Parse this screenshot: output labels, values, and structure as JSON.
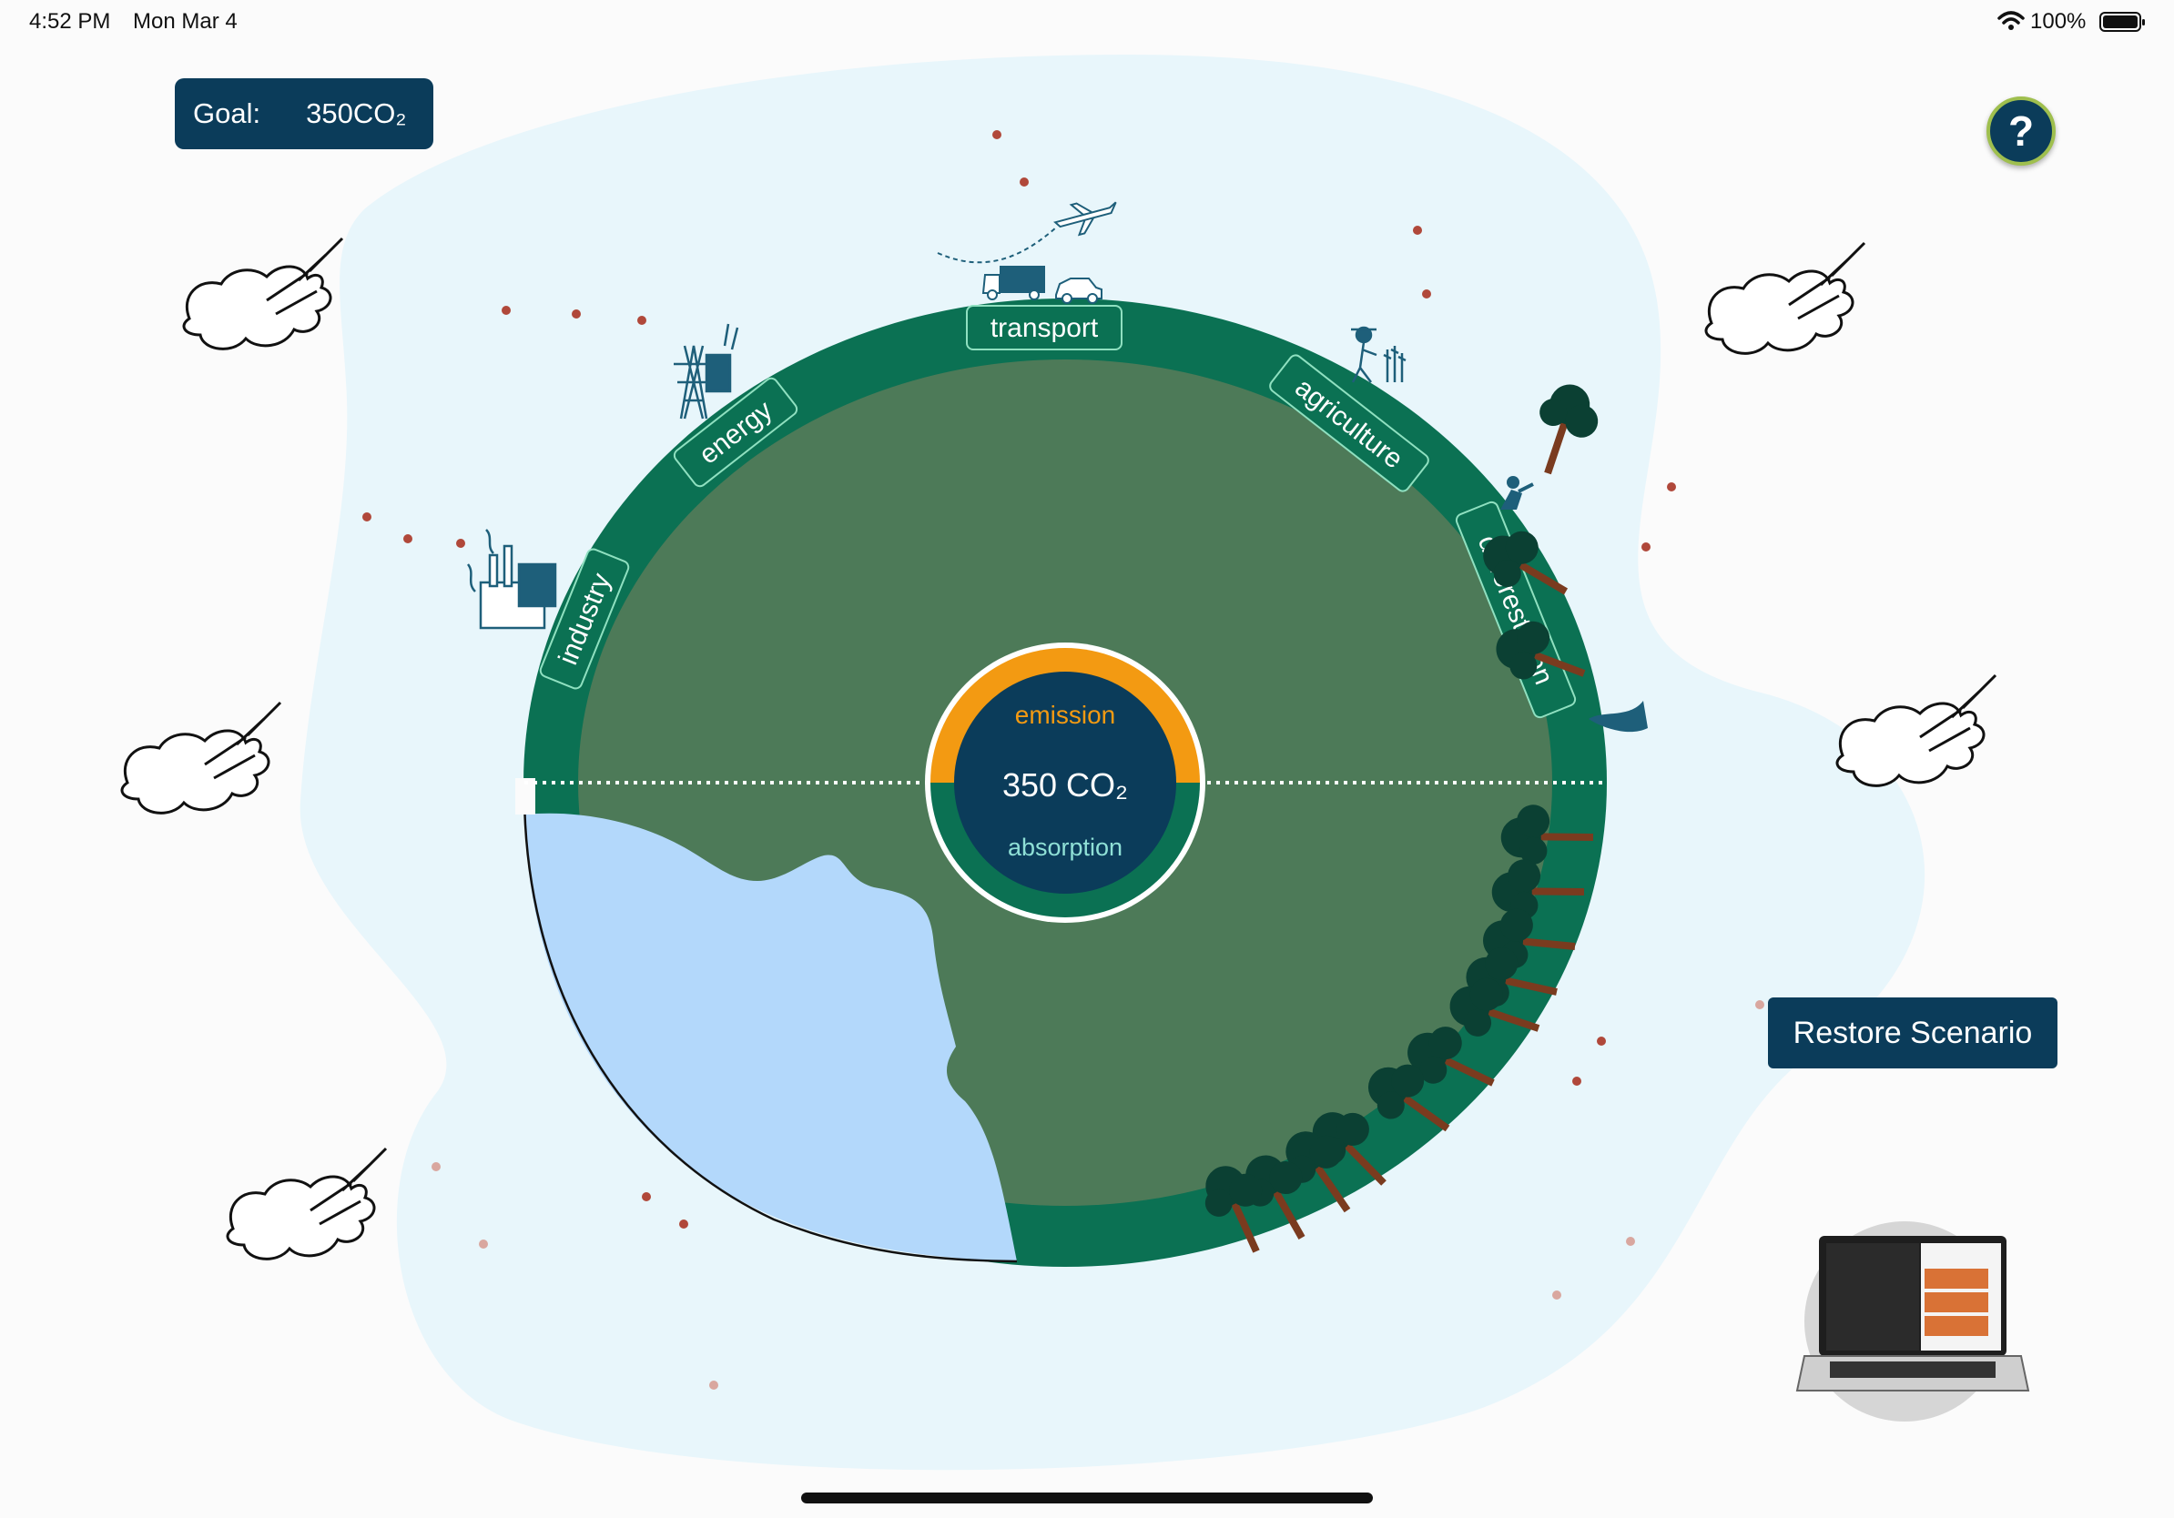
{
  "status_bar": {
    "time": "4:52 PM",
    "date": "Mon Mar 4",
    "battery": "100%"
  },
  "goal": {
    "label": "Goal:",
    "value": "350CO₂"
  },
  "help": {
    "label": "?"
  },
  "globe": {
    "center": {
      "emission_label": "emission",
      "value": "350 CO₂",
      "absorption_label": "absorption"
    },
    "sectors": [
      {
        "name": "industry",
        "label": "industry"
      },
      {
        "name": "energy",
        "label": "energy"
      },
      {
        "name": "transport",
        "label": "transport"
      },
      {
        "name": "agriculture",
        "label": "agriculture"
      },
      {
        "name": "deforestation",
        "label": "deforestation"
      }
    ]
  },
  "restore_button": {
    "label": "Restore Scenario"
  },
  "colors": {
    "navy": "#0b3c5a",
    "ring": "#0b7153",
    "land": "#4d7a58",
    "ocean": "#b3d8fb",
    "emission": "#f39a12",
    "absorption_text": "#8fe0d6",
    "halo": "#e8f6fb",
    "dot": "#b0483a"
  },
  "icons": [
    "wifi-icon",
    "battery-icon",
    "cloud-icon",
    "factory-icon",
    "power-tower-icon",
    "airplane-icon",
    "truck-icon",
    "car-icon",
    "farmer-icon",
    "tree-icon",
    "lumberjack-icon",
    "laptop-icon",
    "help-icon"
  ]
}
